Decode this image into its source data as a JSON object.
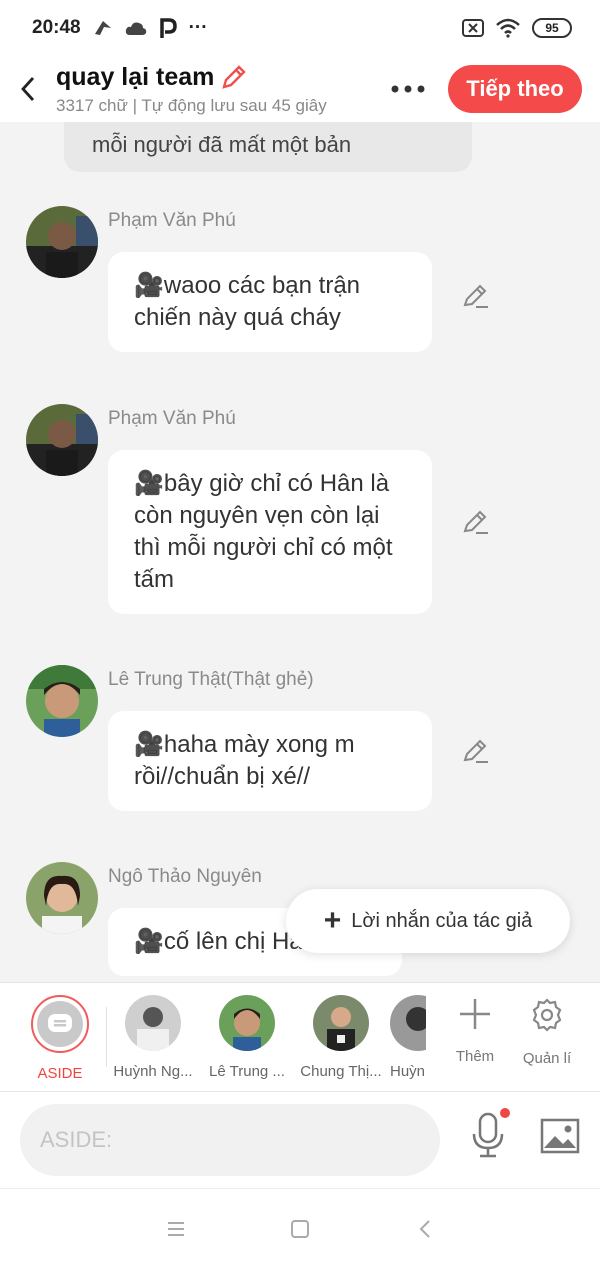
{
  "status": {
    "time": "20:48",
    "battery": "95"
  },
  "header": {
    "title": "quay lại team",
    "subtitle": "3317 chữ | Tự động lưu sau 45 giây",
    "next_label": "Tiếp theo"
  },
  "chat": {
    "previous_text": "mỗi người đã mất một bản",
    "messages": [
      {
        "sender": "Phạm Văn Phú",
        "text": "🎥waoo các bạn trận chiến này quá cháy"
      },
      {
        "sender": "Phạm Văn Phú",
        "text": "🎥bây giờ chỉ có Hân là còn nguyên vẹn còn lại thì mỗi người chỉ có một tấm"
      },
      {
        "sender": "Lê Trung Thật(Thật ghẻ)",
        "text": "🎥haha mày xong m rồi//chuẩn bị xé//"
      },
      {
        "sender": "Ngô Thảo Nguyên",
        "text": "🎥cố lên chị Hân"
      }
    ]
  },
  "author_note": {
    "label": "Lời nhắn của tác giả"
  },
  "characters": [
    {
      "name": "ASIDE"
    },
    {
      "name": "Huỳnh Ng..."
    },
    {
      "name": "Lê Trung ..."
    },
    {
      "name": "Chung Thị..."
    },
    {
      "name": "Huỳn"
    }
  ],
  "tools": {
    "add_label": "Thêm",
    "manage_label": "Quản lí"
  },
  "input": {
    "placeholder": "ASIDE:"
  },
  "colors": {
    "accent": "#f54a4a",
    "background": "#f3f3f3",
    "bubble": "#ffffff"
  }
}
